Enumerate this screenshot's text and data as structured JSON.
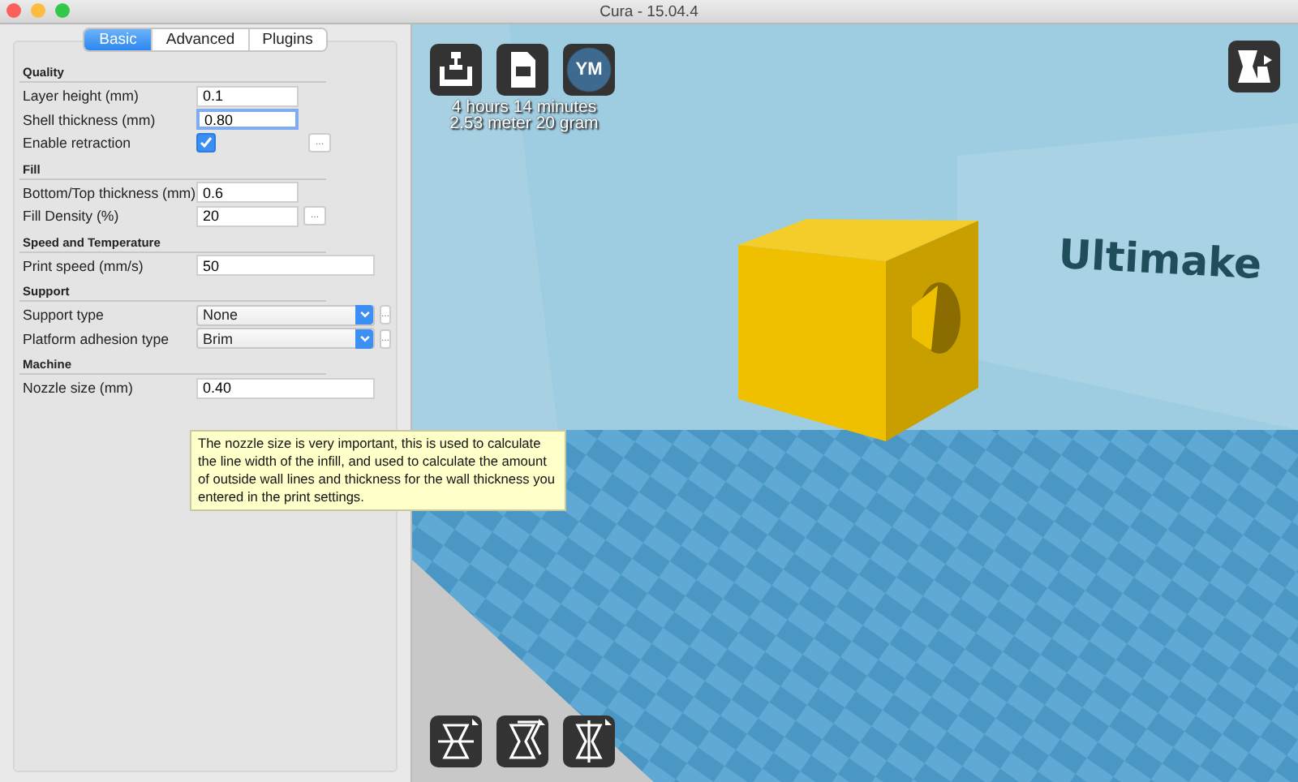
{
  "window": {
    "title": "Cura - 15.04.4"
  },
  "tabs": [
    {
      "label": "Basic",
      "selected": true
    },
    {
      "label": "Advanced",
      "selected": false
    },
    {
      "label": "Plugins",
      "selected": false
    }
  ],
  "sections": [
    {
      "title": "Quality",
      "rows": [
        {
          "kind": "text",
          "label": "Layer height (mm)",
          "value": "0.1",
          "focused": false
        },
        {
          "kind": "text",
          "label": "Shell thickness (mm)",
          "value": "0.80",
          "focused": true
        },
        {
          "kind": "checkbox",
          "label": "Enable retraction",
          "checked": true,
          "more_label": "..."
        }
      ]
    },
    {
      "title": "Fill",
      "rows": [
        {
          "kind": "text",
          "label": "Bottom/Top thickness (mm)",
          "value": "0.6",
          "focused": false
        },
        {
          "kind": "text",
          "label": "Fill Density (%)",
          "value": "20",
          "focused": false,
          "more_label": "..."
        }
      ]
    },
    {
      "title": "Speed and Temperature",
      "rows": [
        {
          "kind": "text",
          "label": "Print speed (mm/s)",
          "value": "50",
          "focused": false
        }
      ]
    },
    {
      "title": "Support",
      "rows": [
        {
          "kind": "select",
          "label": "Support type",
          "value": "None",
          "more_label": "..."
        },
        {
          "kind": "select",
          "label": "Platform adhesion type",
          "value": "Brim",
          "more_label": "..."
        }
      ]
    },
    {
      "title": "Machine",
      "rows": [
        {
          "kind": "text",
          "label": "Nozzle size (mm)",
          "value": "0.40",
          "focused": false
        }
      ]
    }
  ],
  "tooltip": {
    "text": "The nozzle size is very important, this is used to calculate the line width of the infill, and used to calculate the amount of outside wall lines and thickness for the wall thickness you entered in the print settings."
  },
  "viewport": {
    "save_button_label": "YM",
    "print_info": [
      "4 hours 14 minutes",
      "2.53 meter 20 gram"
    ],
    "wall_text": "Ultimake"
  }
}
